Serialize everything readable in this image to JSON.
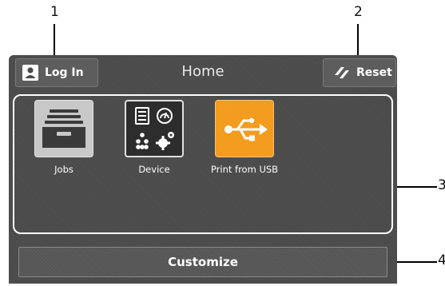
{
  "callouts": [
    "1",
    "2",
    "3",
    "4"
  ],
  "header": {
    "login_label": "Log In",
    "title": "Home",
    "reset_label": "Reset"
  },
  "apps": [
    {
      "label": "Jobs",
      "icon": "jobs-tray-icon"
    },
    {
      "label": "Device",
      "icon": "device-icon"
    },
    {
      "label": "Print from USB",
      "icon": "usb-icon"
    }
  ],
  "customize_label": "Customize",
  "colors": {
    "panel": "#4a4a4a",
    "usb_tile": "#f39a1a",
    "jobs_tile": "#c8c8c8",
    "device_tile": "#2d2d2d"
  }
}
